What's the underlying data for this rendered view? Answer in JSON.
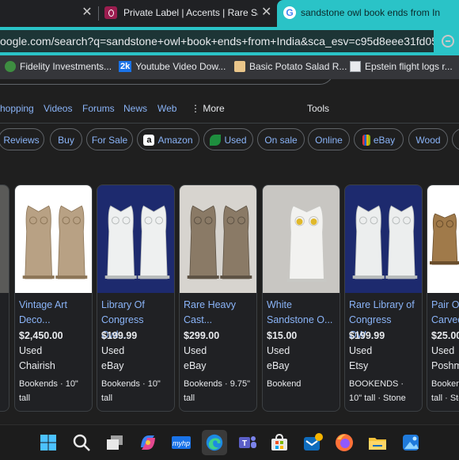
{
  "tabs": {
    "left_close": "✕",
    "tab2_title": "Private Label | Accents | Rare Sand",
    "tab2_close": "✕",
    "active_title": "sandstone owl book ends from In"
  },
  "address_bar": {
    "url": "oogle.com/search?q=sandstone+owl+book+ends+from+India&sca_esv=c95d8eee31fd056..."
  },
  "bookmarks": [
    {
      "label": "Fidelity Investments...",
      "icon": "fidelity-icon"
    },
    {
      "label": "Youtube Video Dow...",
      "icon": "2k-icon",
      "icon_text": "2k"
    },
    {
      "label": "Basic Potato Salad R...",
      "icon": "food-icon"
    },
    {
      "label": "Epstein flight logs r...",
      "icon": "document-icon"
    }
  ],
  "nav": {
    "tabs": [
      "hopping",
      "Videos",
      "Forums",
      "News",
      "Web"
    ],
    "more": "⋮ More",
    "tools": "Tools"
  },
  "chips": [
    {
      "label": "Reviews"
    },
    {
      "label": "Buy"
    },
    {
      "label": "For Sale"
    },
    {
      "label": "Amazon",
      "icon": "amazon-icon",
      "icon_text": "a"
    },
    {
      "label": "Used",
      "icon": "leaf-icon"
    },
    {
      "label": "On sale"
    },
    {
      "label": "Online"
    },
    {
      "label": "eBay",
      "icon": "ebay-icon"
    },
    {
      "label": "Wood"
    }
  ],
  "products": [
    {
      "title": "Vintage Art Deco...",
      "price": "$2,450.00",
      "condition": "Used",
      "seller": "Chairish",
      "desc": "Bookends · 10\" tall",
      "color": "#b8a184"
    },
    {
      "title": "Library Of Congress Owl...",
      "price": "$199.99",
      "condition": "Used",
      "seller": "eBay",
      "desc": "Bookends · 10\" tall",
      "color": "#eef0f0"
    },
    {
      "title": "Rare Heavy Cast...",
      "price": "$299.00",
      "condition": "Used",
      "seller": "eBay",
      "desc": "Bookends · 9.75\" tall",
      "color": "#8a7a66"
    },
    {
      "title": "White Sandstone O...",
      "price": "$15.00",
      "condition": "Used",
      "seller": "eBay",
      "desc": "Bookend",
      "color": "#f2f2f0"
    },
    {
      "title": "Rare Library of Congress OW...",
      "price": "$199.99",
      "condition": "Used",
      "seller": "Etsy",
      "desc": "BOOKENDS · 10\" tall · Stone",
      "color": "#eceeee"
    },
    {
      "title": "Pair Of Carved...",
      "price": "$25.00",
      "condition": "Used",
      "seller": "Poshm",
      "desc": "Bookends · tall · Sto",
      "color": "#a07a4a"
    }
  ],
  "taskbar": [
    "windows-start-icon",
    "search-icon",
    "task-view-icon",
    "copilot-icon",
    "hp-icon",
    "edge-icon",
    "teams-icon",
    "store-icon",
    "mail-icon",
    "firefox-icon",
    "file-explorer-icon",
    "photos-icon"
  ]
}
